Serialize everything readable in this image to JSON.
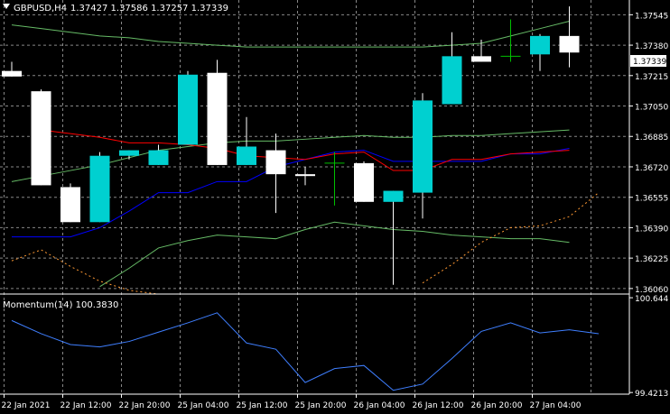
{
  "header": {
    "symbol_label": "GBPUSD,H4",
    "ohlc_text": "1.37427 1.37586 1.37257 1.37339"
  },
  "price_panel": {
    "current_price_label": "1.37339",
    "y_ticks": [
      "1.37545",
      "1.37380",
      "1.37215",
      "1.37050",
      "1.36885",
      "1.36720",
      "1.36555",
      "1.36390",
      "1.36225",
      "1.36060"
    ]
  },
  "momentum_panel": {
    "label": "Momentum(14) 100.3830",
    "y_ticks": [
      "100.644",
      "99.4213"
    ]
  },
  "x_ticks": [
    "22 Jan 2021",
    "22 Jan 12:00",
    "22 Jan 20:00",
    "25 Jan 04:00",
    "25 Jan 12:00",
    "25 Jan 20:00",
    "26 Jan 04:00",
    "26 Jan 12:00",
    "26 Jan 20:00",
    "27 Jan 04:00"
  ],
  "colors": {
    "background": "#000000",
    "grid": "#c0c0c0",
    "bull_candle": "#00d0d0",
    "bear_candle": "#ffffff",
    "wick_bull": "#ffffff",
    "doji_green": "#00c000",
    "ma_red": "#ff0000",
    "ma_blue": "#0000ff",
    "band_green": "#66bb66",
    "momentum_line": "#3f7fff",
    "dotted_orange": "#ff9933"
  },
  "chart_data": {
    "type": "candlestick",
    "timeframe": "H4",
    "symbol": "GBPUSD",
    "candles": [
      {
        "open": 1.3724,
        "high": 1.3729,
        "low": 1.3721,
        "close": 1.3721
      },
      {
        "open": 1.3713,
        "high": 1.3714,
        "low": 1.3662,
        "close": 1.3662
      },
      {
        "open": 1.3661,
        "high": 1.3663,
        "low": 1.3642,
        "close": 1.3642
      },
      {
        "open": 1.3642,
        "high": 1.368,
        "low": 1.3642,
        "close": 1.3678
      },
      {
        "open": 1.3678,
        "high": 1.3681,
        "low": 1.3676,
        "close": 1.3681
      },
      {
        "open": 1.3673,
        "high": 1.3684,
        "low": 1.3673,
        "close": 1.3681
      },
      {
        "open": 1.3684,
        "high": 1.3724,
        "low": 1.3684,
        "close": 1.3722
      },
      {
        "open": 1.3723,
        "high": 1.373,
        "low": 1.3673,
        "close": 1.3673
      },
      {
        "open": 1.3673,
        "high": 1.3699,
        "low": 1.3673,
        "close": 1.3683
      },
      {
        "open": 1.3681,
        "high": 1.369,
        "low": 1.3647,
        "close": 1.3668
      },
      {
        "open": 1.3668,
        "high": 1.3672,
        "low": 1.3662,
        "close": 1.3667
      },
      {
        "open": 1.3674,
        "high": 1.368,
        "low": 1.3651,
        "close": 1.3674
      },
      {
        "open": 1.3674,
        "high": 1.3675,
        "low": 1.3653,
        "close": 1.3653
      },
      {
        "open": 1.3653,
        "high": 1.3659,
        "low": 1.3608,
        "close": 1.3659
      },
      {
        "open": 1.3658,
        "high": 1.3712,
        "low": 1.3644,
        "close": 1.3708
      },
      {
        "open": 1.3706,
        "high": 1.3745,
        "low": 1.3706,
        "close": 1.3732
      },
      {
        "open": 1.3732,
        "high": 1.3741,
        "low": 1.3729,
        "close": 1.3729
      },
      {
        "open": 1.3732,
        "high": 1.3752,
        "low": 1.3729,
        "close": 1.3732
      },
      {
        "open": 1.3733,
        "high": 1.3744,
        "low": 1.3724,
        "close": 1.3743
      },
      {
        "open": 1.3743,
        "high": 1.3759,
        "low": 1.3726,
        "close": 1.3734
      }
    ],
    "ma_red": [
      null,
      1.3692,
      1.369,
      1.3688,
      1.3685,
      1.3685,
      1.3684,
      1.3682,
      1.3678,
      1.3677,
      1.3676,
      1.3679,
      1.368,
      1.367,
      1.367,
      1.3676,
      1.3676,
      1.3679,
      1.368,
      1.3681
    ],
    "ma_blue": [
      1.3634,
      1.3634,
      1.3634,
      1.3639,
      1.3648,
      1.3658,
      1.3658,
      1.3664,
      1.3664,
      1.3672,
      1.3676,
      1.368,
      1.3681,
      1.3675,
      1.3675,
      1.3675,
      1.3675,
      1.3679,
      1.3679,
      1.3682
    ],
    "band_upper": [
      1.3749,
      1.3747,
      1.3745,
      1.3743,
      1.3742,
      1.374,
      1.3739,
      1.3738,
      1.3737,
      1.3737,
      1.3737,
      1.3737,
      1.3737,
      1.3737,
      1.3737,
      1.3738,
      1.3739,
      1.3743,
      1.3747,
      1.3751
    ],
    "band_mid": [
      1.3664,
      1.3667,
      1.367,
      1.3673,
      1.3677,
      1.3681,
      1.3683,
      1.3685,
      1.3686,
      1.3686,
      1.3687,
      1.3688,
      1.3689,
      1.3688,
      1.3688,
      1.3689,
      1.3689,
      1.369,
      1.3691,
      1.3692
    ],
    "band_lower": [
      null,
      null,
      null,
      1.3607,
      1.3617,
      1.3628,
      1.3632,
      1.3635,
      1.3634,
      1.3633,
      1.3638,
      1.3642,
      1.364,
      1.3638,
      1.3637,
      1.3635,
      1.3634,
      1.3633,
      1.3633,
      1.3631
    ],
    "orange_dotted": [
      1.3621,
      1.3627,
      1.3618,
      1.361,
      1.3605,
      1.3603,
      null,
      null,
      null,
      null,
      null,
      null,
      null,
      null,
      1.3609,
      1.3619,
      1.3631,
      1.3639,
      1.364,
      1.3645,
      1.3658
    ],
    "momentum": [
      100.35,
      100.18,
      100.04,
      100.01,
      100.08,
      100.2,
      100.32,
      100.45,
      100.06,
      99.98,
      99.55,
      99.73,
      99.77,
      99.45,
      99.53,
      99.86,
      100.21,
      100.32,
      100.19,
      100.23,
      100.18
    ],
    "price_range": [
      1.3603,
      1.37625
    ],
    "momentum_range": [
      99.4,
      100.68
    ]
  }
}
